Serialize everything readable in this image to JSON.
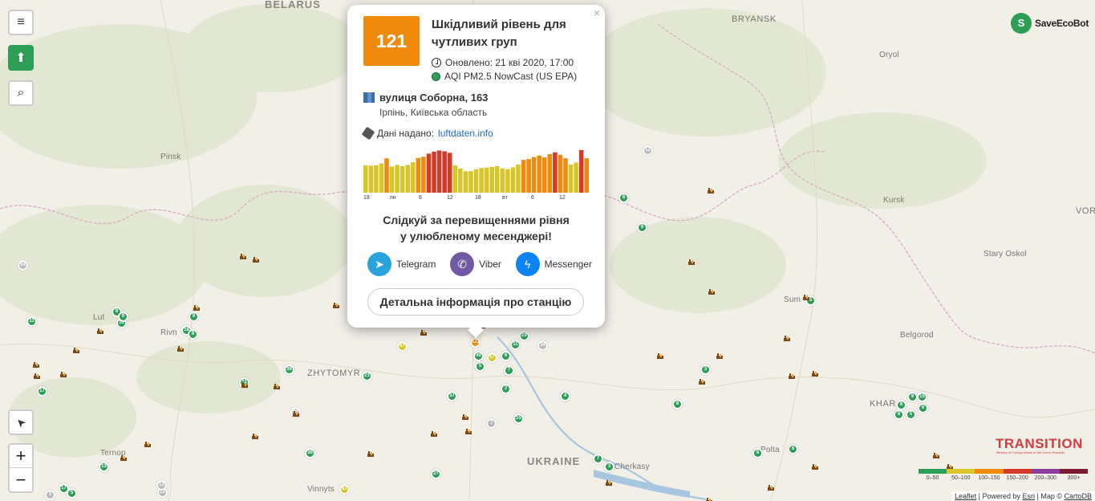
{
  "map": {
    "places": [
      {
        "name": "BELARUS",
        "cls": "big"
      },
      {
        "name": "BRYANSK",
        "cls": "mid"
      },
      {
        "name": "Oryol",
        "cls": ""
      },
      {
        "name": "Pinsk",
        "cls": ""
      },
      {
        "name": "Kursk",
        "cls": ""
      },
      {
        "name": "VOR",
        "cls": "mid"
      },
      {
        "name": "Stary Oskol",
        "cls": ""
      },
      {
        "name": "Lut",
        "cls": ""
      },
      {
        "name": "Rivn",
        "cls": ""
      },
      {
        "name": "Sum",
        "cls": ""
      },
      {
        "name": "Belgorod",
        "cls": ""
      },
      {
        "name": "ZHYTOMYR",
        "cls": "mid"
      },
      {
        "name": "KHAR",
        "cls": "mid"
      },
      {
        "name": "Ternop",
        "cls": ""
      },
      {
        "name": "UKRAINE",
        "cls": "big"
      },
      {
        "name": "Cherkasy",
        "cls": ""
      },
      {
        "name": "Polta",
        "cls": ""
      },
      {
        "name": "Vinnyts",
        "cls": ""
      }
    ],
    "markers": [
      {
        "v": "12",
        "c": "gr"
      },
      {
        "v": "8",
        "c": "g"
      },
      {
        "v": "9",
        "c": "g"
      },
      {
        "v": "54",
        "c": "gr"
      },
      {
        "v": "8",
        "c": "g"
      },
      {
        "v": "18",
        "c": "g"
      },
      {
        "v": "9",
        "c": "g"
      },
      {
        "v": "11",
        "c": "g"
      },
      {
        "v": "16",
        "c": "g"
      },
      {
        "v": "9",
        "c": "g"
      },
      {
        "v": "8",
        "c": "g"
      },
      {
        "v": "67",
        "c": "y"
      },
      {
        "v": "121",
        "c": "o"
      },
      {
        "v": "40",
        "c": "g"
      },
      {
        "v": "57",
        "c": "y"
      },
      {
        "v": "5",
        "c": "g"
      },
      {
        "v": "7",
        "c": "g"
      },
      {
        "v": "6",
        "c": "g"
      },
      {
        "v": "11",
        "c": "g"
      },
      {
        "v": "29",
        "c": "g"
      },
      {
        "v": "34",
        "c": "gr"
      },
      {
        "v": "2",
        "c": "g"
      },
      {
        "v": "4",
        "c": "g"
      },
      {
        "v": "38",
        "c": "g"
      },
      {
        "v": "21",
        "c": "g"
      },
      {
        "v": "11",
        "c": "g"
      },
      {
        "v": "17",
        "c": "g"
      },
      {
        "v": "37",
        "c": "g"
      },
      {
        "v": "15",
        "c": "g"
      },
      {
        "v": "50",
        "c": "gr"
      },
      {
        "v": "7",
        "c": "gr"
      },
      {
        "v": "8",
        "c": "g"
      },
      {
        "v": "3",
        "c": "g"
      },
      {
        "v": "5",
        "c": "g"
      },
      {
        "v": "13",
        "c": "g"
      },
      {
        "v": "36",
        "c": "g"
      },
      {
        "v": "27",
        "c": "g"
      },
      {
        "v": "17",
        "c": "g"
      },
      {
        "v": "5",
        "c": "g"
      },
      {
        "v": "22",
        "c": "gr"
      },
      {
        "v": "61",
        "c": "y"
      },
      {
        "v": "8",
        "c": "g"
      },
      {
        "v": "3",
        "c": "g"
      },
      {
        "v": "9",
        "c": "g"
      },
      {
        "v": "15",
        "c": "g"
      },
      {
        "v": "8",
        "c": "g"
      },
      {
        "v": "5",
        "c": "g"
      },
      {
        "v": "6",
        "c": "g"
      },
      {
        "v": "8",
        "c": "g"
      },
      {
        "v": "7",
        "c": "g"
      },
      {
        "v": "6",
        "c": "g"
      },
      {
        "v": "13",
        "c": "gr"
      },
      {
        "v": "3",
        "c": "gr"
      }
    ]
  },
  "controls": {
    "menu_icon": "≡",
    "donate_icon": "⬆",
    "search_icon": "⌕",
    "locate_icon": "➤",
    "zoom_in": "+",
    "zoom_out": "−"
  },
  "brand": {
    "name": "SaveEcoBot",
    "logo_glyph": "S"
  },
  "transition": {
    "name": "TRANSITION",
    "sub": "Ministry of Foreign Affairs of the Czech Republic"
  },
  "legend": {
    "colors": [
      "#2e9d55",
      "#d8c628",
      "#f08a0c",
      "#d43a2a",
      "#8a3d9c",
      "#7b1d2e"
    ],
    "labels": [
      "0–50",
      "50–100",
      "100–150",
      "150–200",
      "200–300",
      "300+"
    ]
  },
  "attribution": {
    "leaflet": "Leaflet",
    "powered": " | Powered by ",
    "esri": "Esri",
    "map": " | Map © ",
    "carto": "CartoDB"
  },
  "popup": {
    "close": "×",
    "aqi": "121",
    "aqi_color": "#f08a0c",
    "title": "Шкідливий рівень для чутливих груп",
    "updated": "Оновлено: 21 кві 2020, 17:00",
    "index": "AQI PM2.5 NowCast (US EPA)",
    "address": "вулиця Соборна, 163",
    "city": "Ірпінь, Київська область",
    "source_label": "Дані надано:",
    "source_link": "luftdaten.info",
    "history": {
      "values": [
        70,
        69,
        70,
        75,
        88,
        67,
        71,
        68,
        71,
        78,
        89,
        92,
        100,
        105,
        108,
        106,
        102,
        70,
        62,
        55,
        55,
        60,
        63,
        64,
        66,
        68,
        62,
        60,
        65,
        72,
        84,
        86,
        91,
        95,
        90,
        99,
        103,
        97,
        88,
        72,
        77,
        109,
        88
      ],
      "axis": [
        "18",
        "пн",
        "6",
        "12",
        "18",
        "вт",
        "6",
        "12"
      ]
    },
    "promo_line1": "Слідкуй за перевищеннями рівня",
    "promo_line2": "у улюбленому месенджері!",
    "messengers": [
      {
        "name": "Telegram",
        "icon": "telegram-icon",
        "glyph": "➤"
      },
      {
        "name": "Viber",
        "icon": "viber-icon",
        "glyph": "✆"
      },
      {
        "name": "Messenger",
        "icon": "messenger-icon",
        "glyph": "ϟ"
      }
    ],
    "details_button": "Детальна інформація про станцію"
  }
}
